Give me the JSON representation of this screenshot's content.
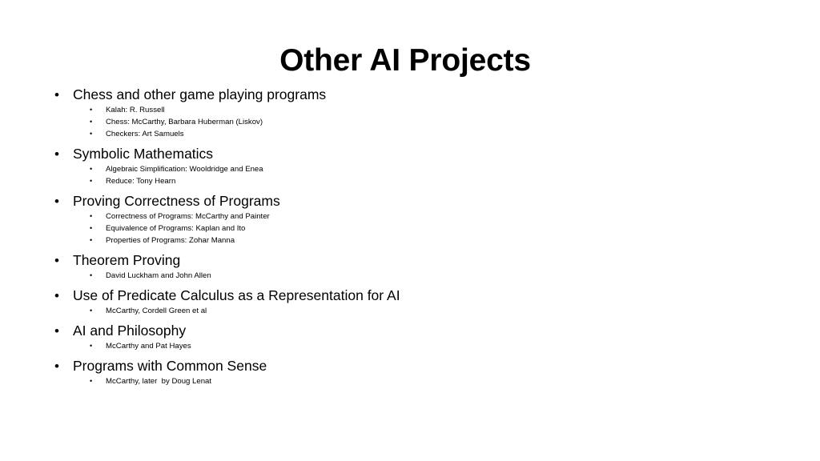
{
  "slide": {
    "title": "Other AI Projects",
    "background_color": "#ffffff",
    "text_color": "#000000",
    "bullet_glyph_level1": "•",
    "bullet_glyph_level2": "•",
    "sections": [
      {
        "heading": "Chess and other game playing programs",
        "items": [
          "Kalah: R. Russell",
          "Chess: McCarthy, Barbara Huberman (Liskov)",
          "Checkers: Art Samuels"
        ]
      },
      {
        "heading": "Symbolic Mathematics",
        "items": [
          "Algebraic Simplification: Wooldridge and Enea",
          "Reduce: Tony Hearn"
        ]
      },
      {
        "heading": "Proving Correctness of Programs",
        "items": [
          "Correctness of Programs: McCarthy and Painter",
          "Equivalence of Programs: Kaplan and Ito",
          "Properties of Programs: Zohar Manna"
        ]
      },
      {
        "heading": "Theorem Proving",
        "items": [
          "David Luckham and John Allen"
        ]
      },
      {
        "heading": "Use of Predicate Calculus as a Representation for AI",
        "items": [
          "McCarthy, Cordell Green et al"
        ]
      },
      {
        "heading": "AI and Philosophy",
        "items": [
          "McCarthy and Pat Hayes"
        ]
      },
      {
        "heading": "Programs with Common Sense",
        "items": [
          "McCarthy, later  by Doug Lenat"
        ]
      }
    ]
  }
}
